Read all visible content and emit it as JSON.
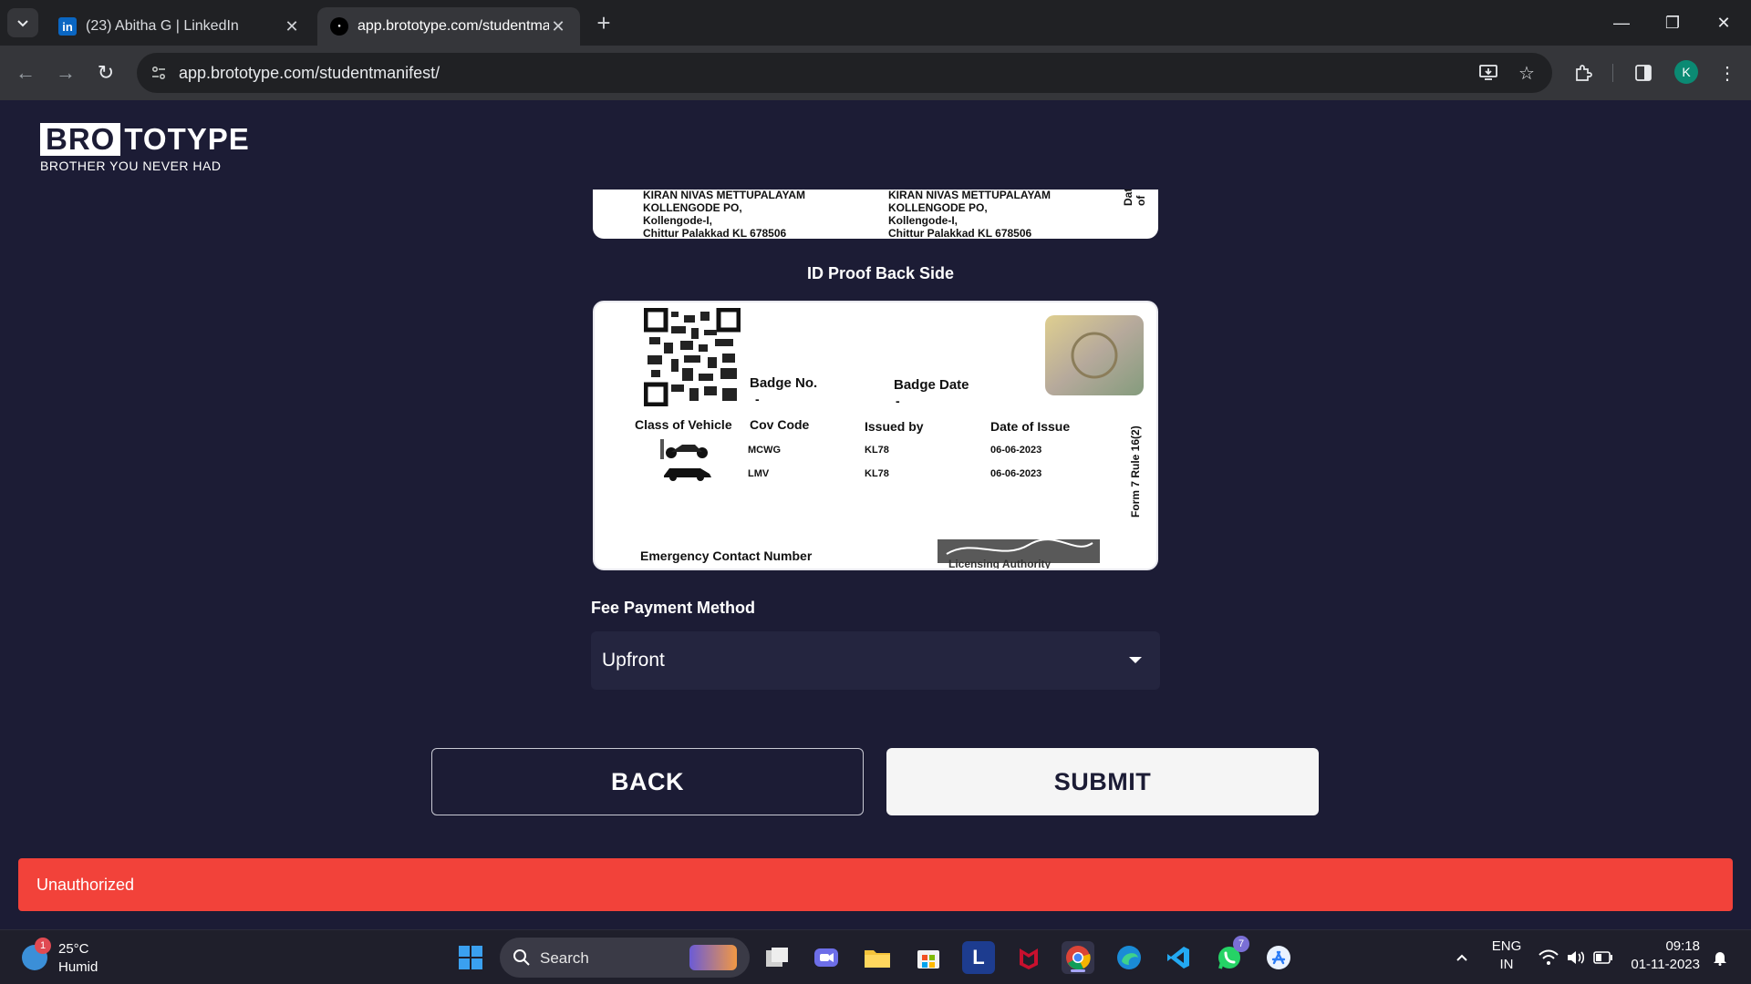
{
  "browser": {
    "tabs": [
      {
        "title": "(23) Abitha G | LinkedIn",
        "favicon": "linkedin-icon",
        "active": false
      },
      {
        "title": "app.brototype.com/studentmanifest/",
        "favicon": "brototype-icon",
        "active": true
      }
    ],
    "url": "app.brototype.com/studentmanifest/",
    "profile_initial": "K"
  },
  "brand": {
    "logo_bold": "BRO",
    "logo_rest": "TOTYPE",
    "tagline": "BROTHER YOU NEVER HAD"
  },
  "id_front_snippet": {
    "col1": [
      "KIRAN NIVAS METTUPALAYAM",
      "KOLLENGODE PO,",
      "Kollengode-I,",
      "Chittur Palakkad KL 678506"
    ],
    "col2": [
      "KIRAN NIVAS METTUPALAYAM",
      "KOLLENGODE PO,",
      "Kollengode-I,",
      "Chittur Palakkad KL 678506"
    ],
    "side_text": "Date of"
  },
  "id_proof_back": {
    "label": "ID Proof Back Side",
    "badge_no": "Badge No.",
    "badge_date": "Badge Date",
    "dash": "-",
    "headers": [
      "Class of Vehicle",
      "Cov Code",
      "Issued by",
      "Date of Issue"
    ],
    "rows": [
      {
        "cov": "MCWG",
        "issued": "KL78",
        "date": "06-06-2023"
      },
      {
        "cov": "LMV",
        "issued": "KL78",
        "date": "06-06-2023"
      }
    ],
    "side_text": "Form 7 Rule 16(2)",
    "emergency": "Emergency Contact Number",
    "authority": "Licensing Authority"
  },
  "form": {
    "fee_label": "Fee Payment Method",
    "fee_value": "Upfront",
    "back_label": "BACK",
    "submit_label": "SUBMIT"
  },
  "toast": {
    "message": "Unauthorized",
    "color": "#f2423a"
  },
  "taskbar": {
    "weather_temp": "25°C",
    "weather_desc": "Humid",
    "weather_badge": "1",
    "search_placeholder": "Search",
    "whatsapp_badge": "7",
    "lang_top": "ENG",
    "lang_bottom": "IN",
    "time": "09:18",
    "date": "01-11-2023"
  },
  "colors": {
    "page_bg": "#1c1c35",
    "accent_toast": "#f2423a",
    "submit_bg": "#f5f5f5"
  }
}
